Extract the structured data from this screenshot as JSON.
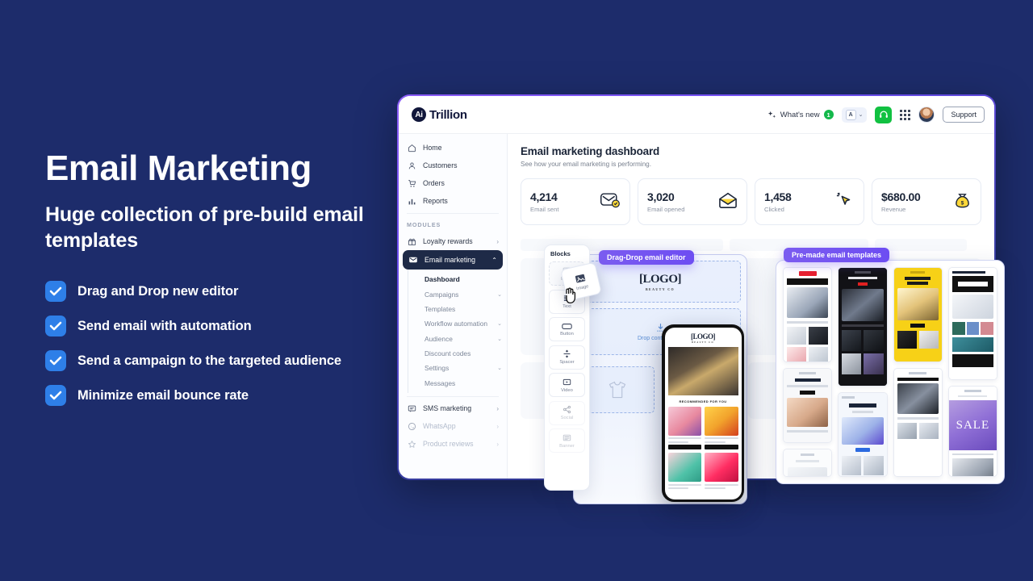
{
  "hero": {
    "title": "Email Marketing",
    "subtitle": "Huge collection of pre-build email templates",
    "features": [
      "Drag and Drop new editor",
      "Send email with automation",
      "Send a campaign to the targeted audience",
      "Minimize email bounce rate"
    ]
  },
  "colors": {
    "page_background": "#1d2c6b",
    "checkbox": "#2e7fe8",
    "accent_purple": "#6d4df2",
    "badge_green": "#14b84b",
    "active_nav": "#1e2a47"
  },
  "topbar": {
    "logo_badge": "Ai",
    "logo_text": "Trillion",
    "whats_new": "What's new",
    "whats_new_count": "1",
    "lang_label": "A",
    "support": "Support",
    "icons": [
      "sparkle-icon",
      "language-icon",
      "chevron-down-icon",
      "headset-icon",
      "apps-grid-icon",
      "avatar"
    ]
  },
  "sidebar": {
    "primary": [
      {
        "label": "Home",
        "icon": "home-icon"
      },
      {
        "label": "Customers",
        "icon": "user-icon"
      },
      {
        "label": "Orders",
        "icon": "cart-icon"
      },
      {
        "label": "Reports",
        "icon": "bar-chart-icon"
      }
    ],
    "section_label": "MODULES",
    "modules": [
      {
        "label": "Loyalty rewards",
        "icon": "gift-icon",
        "chevron": "›",
        "active": false,
        "dim": false
      },
      {
        "label": "Email marketing",
        "icon": "mail-icon",
        "chevron": "⌃",
        "active": true,
        "dim": false
      }
    ],
    "email_submenu": [
      {
        "label": "Dashboard",
        "selected": true,
        "chevron": ""
      },
      {
        "label": "Campaigns",
        "selected": false,
        "chevron": "⌄"
      },
      {
        "label": "Templates",
        "selected": false,
        "chevron": ""
      },
      {
        "label": "Workflow automation",
        "selected": false,
        "chevron": "⌄"
      },
      {
        "label": "Audience",
        "selected": false,
        "chevron": "⌄"
      },
      {
        "label": "Discount codes",
        "selected": false,
        "chevron": ""
      },
      {
        "label": "Settings",
        "selected": false,
        "chevron": "⌄"
      },
      {
        "label": "Messages",
        "selected": false,
        "chevron": ""
      }
    ],
    "modules_bottom": [
      {
        "label": "SMS marketing",
        "icon": "chat-icon",
        "chevron": "›",
        "dim": false
      },
      {
        "label": "WhatsApp",
        "icon": "whatsapp-icon",
        "chevron": "›",
        "dim": true
      },
      {
        "label": "Product reviews",
        "icon": "star-icon",
        "chevron": "›",
        "dim": true
      }
    ]
  },
  "main": {
    "title": "Email marketing dashboard",
    "subtitle": "See how your email marketing is performing.",
    "stats": [
      {
        "value": "4,214",
        "label": "Email sent",
        "icon": "email-sent-icon"
      },
      {
        "value": "3,020",
        "label": "Email opened",
        "icon": "email-opened-icon"
      },
      {
        "value": "1,458",
        "label": "Clicked",
        "icon": "click-cursor-icon"
      },
      {
        "value": "$680.00",
        "label": "Revenue",
        "icon": "money-bag-icon"
      }
    ]
  },
  "editor": {
    "badge_editor": "Drag-Drop email editor",
    "badge_templates": "Pre-made email templates",
    "blocks_title": "Blocks",
    "blocks": [
      {
        "label": "Image",
        "icon": "image-icon"
      },
      {
        "label": "Text",
        "icon": "text-lines-icon"
      },
      {
        "label": "Button",
        "icon": "button-icon"
      },
      {
        "label": "Spacer",
        "icon": "spacer-icon"
      },
      {
        "label": "Video",
        "icon": "video-icon"
      },
      {
        "label": "Social",
        "icon": "share-icon"
      },
      {
        "label": "Banner",
        "icon": "banner-icon"
      }
    ],
    "drag_tile_label": "Image",
    "canvas_logo": "[LOGO]",
    "canvas_logo_sub": "BEAUTY CO",
    "drop_text": "Drop content here"
  },
  "phone": {
    "logo": "[LOGO]",
    "logo_sub": "BEAUTY CO",
    "section_label": "RECOMMENDED FOR YOU"
  }
}
